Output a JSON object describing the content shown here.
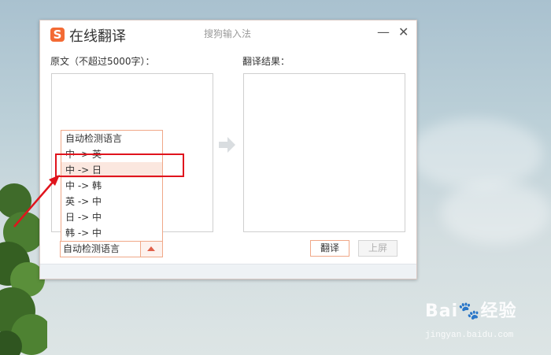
{
  "window": {
    "logo_letter": "S",
    "title": "在线翻译",
    "subtitle": "搜狗输入法",
    "minimize": "—",
    "close": "✕"
  },
  "source": {
    "label": "原文（不超过5000字）："
  },
  "result": {
    "label": "翻译结果："
  },
  "dropdown": {
    "items": [
      {
        "label": "自动检测语言"
      },
      {
        "label": "中 -> 英"
      },
      {
        "label": "中 -> 日"
      },
      {
        "label": "中 -> 韩"
      },
      {
        "label": "英 -> 中"
      },
      {
        "label": "日 -> 中"
      },
      {
        "label": "韩 -> 中"
      }
    ],
    "highlighted_index": 2,
    "selected_value": "自动检测语言"
  },
  "buttons": {
    "translate": "翻译",
    "screen": "上屏"
  },
  "watermark": {
    "brand": "Bai🐾经验",
    "url": "jingyan.baidu.com"
  },
  "colors": {
    "accent": "#f36a34",
    "annotation": "#e0141d"
  }
}
